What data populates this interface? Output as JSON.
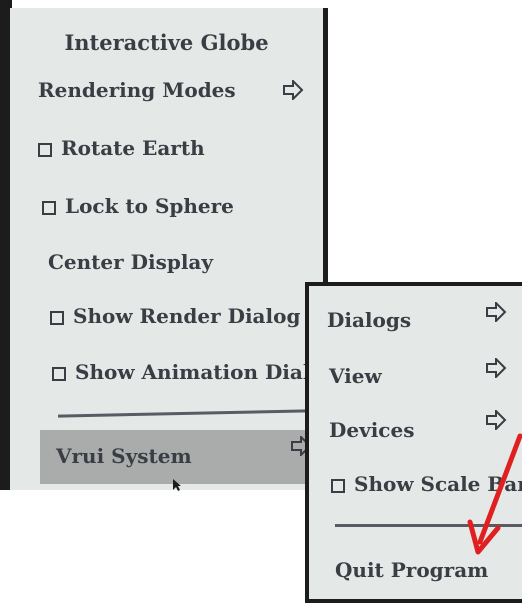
{
  "main_menu": {
    "title": "Interactive Globe",
    "items": [
      {
        "label": "Rendering Modes",
        "type": "submenu"
      },
      {
        "label": "Rotate Earth",
        "type": "checkbox",
        "checked": false
      },
      {
        "label": "Lock to Sphere",
        "type": "checkbox",
        "checked": false
      },
      {
        "label": "Center Display",
        "type": "action"
      },
      {
        "label": "Show Render Dialog",
        "type": "checkbox",
        "checked": false
      },
      {
        "label": "Show Animation Dialog",
        "type": "checkbox",
        "checked": false
      },
      {
        "label": "Vrui System",
        "type": "submenu",
        "highlighted": true
      }
    ]
  },
  "sub_menu": {
    "items": [
      {
        "label": "Dialogs",
        "type": "submenu"
      },
      {
        "label": "View",
        "type": "submenu"
      },
      {
        "label": "Devices",
        "type": "submenu"
      },
      {
        "label": "Show Scale Bar",
        "type": "checkbox",
        "checked": false
      },
      {
        "label": "Quit Program",
        "type": "action"
      }
    ]
  },
  "colors": {
    "menu_bg": "#e4e8e6",
    "highlight_bg": "#a9acab",
    "text": "#3a3e44",
    "annotation_arrow": "#e02020"
  },
  "icons": [
    "submenu-arrow-icon",
    "checkbox-icon",
    "mouse-cursor-icon",
    "red-annotation-arrow"
  ]
}
